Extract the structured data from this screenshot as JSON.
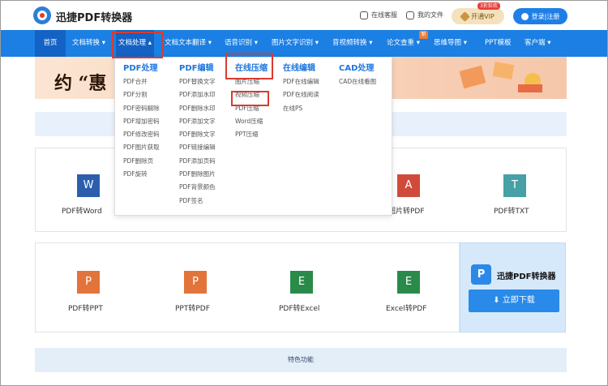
{
  "header": {
    "brand": "迅捷PDF转换器",
    "service": "在线客服",
    "files": "我的文件",
    "vip_label": "开通VIP",
    "vip_badge": "3折狂欢",
    "login": "登录|注册"
  },
  "nav": {
    "items": [
      "首页",
      "文档转换",
      "文档处理",
      "文档文本翻译",
      "语音识别",
      "图片文字识别",
      "音视频转换",
      "论文查重",
      "思维导图",
      "PPT模板",
      "客户端"
    ],
    "new_badge": "新",
    "active": "文档处理"
  },
  "dropdown": {
    "columns": [
      {
        "title": "PDF处理",
        "items": [
          "PDF合并",
          "PDF分割",
          "PDF密码解除",
          "PDF增加密码",
          "PDF修改密码",
          "PDF图片获取",
          "PDF删除页",
          "PDF旋转"
        ]
      },
      {
        "title": "PDF编辑",
        "items": [
          "PDF替换文字",
          "PDF添加水印",
          "PDF删除水印",
          "PDF添加文字",
          "PDF删除文字",
          "PDF链接编辑",
          "PDF添加页码",
          "PDF删除图片",
          "PDF背景颜色",
          "PDF签名"
        ]
      },
      {
        "title": "在线压缩",
        "items": [
          "图片压缩",
          "视频压缩",
          "PDF压缩",
          "Word压缩",
          "PPT压缩"
        ]
      },
      {
        "title": "在线编辑",
        "items": [
          "PDF在线编辑",
          "PDF在线阅读",
          "在线PS"
        ]
      },
      {
        "title": "CAD处理",
        "items": [
          "CAD在线看图"
        ]
      }
    ]
  },
  "banner": {
    "text": "约 “惠"
  },
  "tiles": {
    "row1": [
      {
        "label": "PDF转Word",
        "icon": "W",
        "color": "#2b5fad"
      },
      {
        "label": "图片转PDF",
        "icon": "A",
        "color": "#d04a3c"
      },
      {
        "label": "PDF转TXT",
        "icon": "T",
        "color": "#46a0a6"
      }
    ],
    "row2": [
      {
        "label": "PDF转PPT",
        "icon": "P",
        "color": "#e2733a"
      },
      {
        "label": "PPT转PDF",
        "icon": "P",
        "color": "#e2733a"
      },
      {
        "label": "PDF转Excel",
        "icon": "E",
        "color": "#2a8a4a"
      },
      {
        "label": "Excel转PDF",
        "icon": "E",
        "color": "#2a8a4a"
      }
    ]
  },
  "download": {
    "brand": "迅捷PDF转换器",
    "logo_letter": "P",
    "button": "立即下载"
  },
  "feature": "特色功能",
  "colors": {
    "nav": "#1b7fe4",
    "highlight": "#d93b30",
    "column_title": "#1b75dd"
  }
}
